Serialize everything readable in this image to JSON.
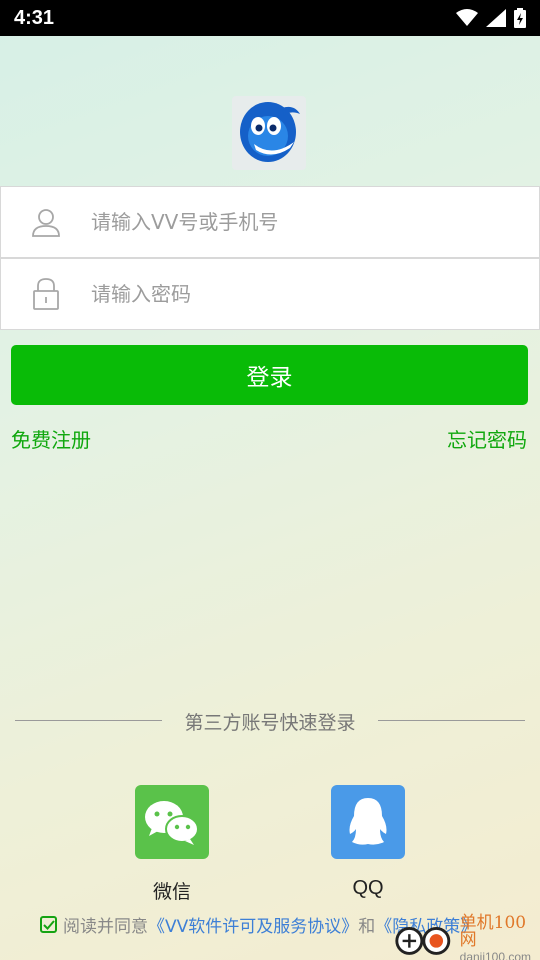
{
  "status_bar": {
    "time": "4:31"
  },
  "login": {
    "account_placeholder": "请输入VV号或手机号",
    "password_placeholder": "请输入密码",
    "login_button": "登录",
    "register_link": "免费注册",
    "forgot_link": "忘记密码"
  },
  "third_party": {
    "divider_text": "第三方账号快速登录",
    "wechat_label": "微信",
    "qq_label": "QQ"
  },
  "agreement": {
    "prefix": "阅读并同意",
    "terms": "《VV软件许可及服务协议》",
    "and": "和",
    "privacy": "《隐私政策》"
  },
  "watermark": {
    "title": "单机100网",
    "domain": "danji100.com"
  },
  "colors": {
    "accent": "#09bb07",
    "link_green": "#10a80e",
    "wechat": "#5ac24a",
    "qq": "#4a9ae8",
    "link_blue": "#3d7fd6"
  },
  "icons": [
    "wifi-icon",
    "signal-icon",
    "battery-icon",
    "user-icon",
    "lock-icon",
    "wechat-icon",
    "qq-icon",
    "checkbox-icon"
  ]
}
